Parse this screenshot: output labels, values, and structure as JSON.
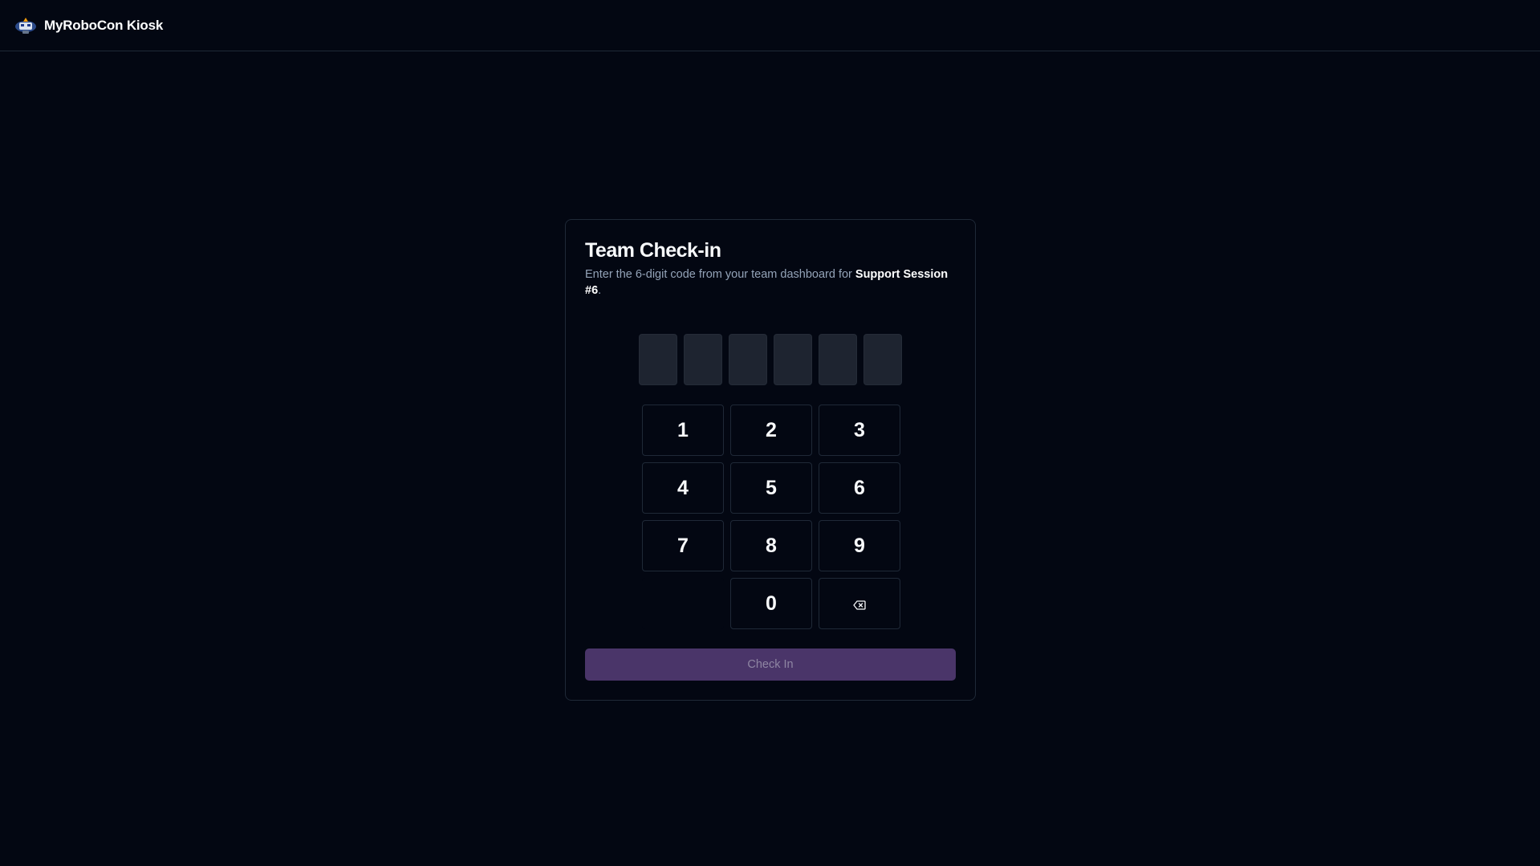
{
  "header": {
    "logo_icon": "robot-mascot-logo",
    "app_title": "MyRoboCon Kiosk"
  },
  "card": {
    "title": "Team Check-in",
    "description_prefix": "Enter the 6-digit code from your team dashboard for ",
    "session_name": "Support Session #6",
    "description_suffix": ".",
    "code_digits": [
      "",
      "",
      "",
      "",
      "",
      ""
    ],
    "keypad": {
      "k1": "1",
      "k2": "2",
      "k3": "3",
      "k4": "4",
      "k5": "5",
      "k6": "6",
      "k7": "7",
      "k8": "8",
      "k9": "9",
      "k0": "0",
      "backspace_icon": "backspace-icon"
    },
    "submit_label": "Check In"
  },
  "colors": {
    "background": "#030712",
    "border": "#1f2937",
    "code_box": "#1e2430",
    "submit_bg": "#4a3569",
    "submit_text": "#8f86a3"
  }
}
